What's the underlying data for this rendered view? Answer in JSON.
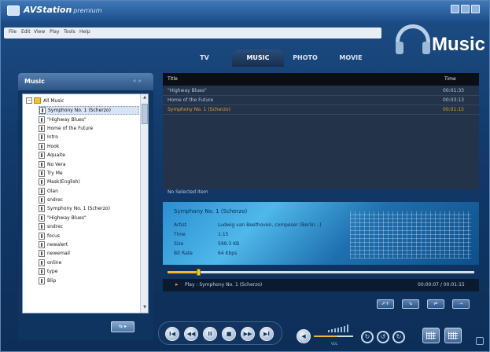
{
  "app": {
    "title": "AVStation",
    "edition": "premium",
    "section": "Music"
  },
  "menu": [
    "File",
    "Edit",
    "View",
    "Play",
    "Tools",
    "Help"
  ],
  "tabs": [
    {
      "label": "TV",
      "active": false
    },
    {
      "label": "MUSIC",
      "active": true
    },
    {
      "label": "PHOTO",
      "active": false
    },
    {
      "label": "MOVIE",
      "active": false
    }
  ],
  "left": {
    "header": "Music",
    "arrows": "« »",
    "root": "All Music",
    "expander": "−",
    "items": [
      {
        "label": "Symphony No. 1 (Scherzo)",
        "selected": true
      },
      {
        "label": "\"Highway Blues\"",
        "selected": false
      },
      {
        "label": "Home of the Future",
        "selected": false
      },
      {
        "label": "Intro",
        "selected": false
      },
      {
        "label": "Hook",
        "selected": false
      },
      {
        "label": "Aquaite",
        "selected": false
      },
      {
        "label": "No Vera",
        "selected": false
      },
      {
        "label": "Try Me",
        "selected": false
      },
      {
        "label": "Mask(English)",
        "selected": false
      },
      {
        "label": "Olan",
        "selected": false
      },
      {
        "label": "sndrec",
        "selected": false
      },
      {
        "label": "Symphony No. 1 (Scherzo)",
        "selected": false
      },
      {
        "label": "\"Highway Blues\"",
        "selected": false
      },
      {
        "label": "sndrec",
        "selected": false
      },
      {
        "label": "focus",
        "selected": false
      },
      {
        "label": "newalert",
        "selected": false
      },
      {
        "label": "newemail",
        "selected": false
      },
      {
        "label": "online",
        "selected": false
      },
      {
        "label": "type",
        "selected": false
      },
      {
        "label": "Blip",
        "selected": false
      }
    ],
    "action_label": "⇆ ▸"
  },
  "playlist": {
    "col_title": "Title",
    "col_time": "Time",
    "rows": [
      {
        "title": "\"Highway Blues\"",
        "time": "00:01:33",
        "selected": false
      },
      {
        "title": "Home of the Future",
        "time": "00:03:13",
        "selected": false
      },
      {
        "title": "Symphony No. 1 (Scherzo)",
        "time": "00:01:15",
        "selected": true
      }
    ]
  },
  "selected_items": "No Selected Item",
  "info": {
    "song": "Symphony No. 1 (Scherzo)",
    "artist_k": "Artist",
    "artist_v": "Ludwig van Beethoven, composer (Berlin...)",
    "time_k": "Time",
    "time_v": "1:15",
    "size_k": "Size",
    "size_v": "599.3 KB",
    "bitrate_k": "Bit Rate",
    "bitrate_v": "64 Kbps"
  },
  "progress": 0.1,
  "nowplaying": {
    "arrow": "▸",
    "text": "Play : Symphony No. 1 (Scherzo)",
    "time": "00:00:07 / 00:01:15"
  },
  "small_buttons": [
    "⇗+",
    "⇘",
    "⇌",
    "⇢"
  ],
  "transport": [
    "I◀",
    "◀◀",
    "II",
    "■",
    "▶▶",
    "▶I"
  ],
  "volume": {
    "icon": "◀",
    "level": 0.6,
    "label": "VOL"
  },
  "repeat_buttons": [
    "↻",
    "↺",
    "↻"
  ],
  "colors": {
    "accent": "#e89a2e",
    "panel": "#23344a"
  }
}
